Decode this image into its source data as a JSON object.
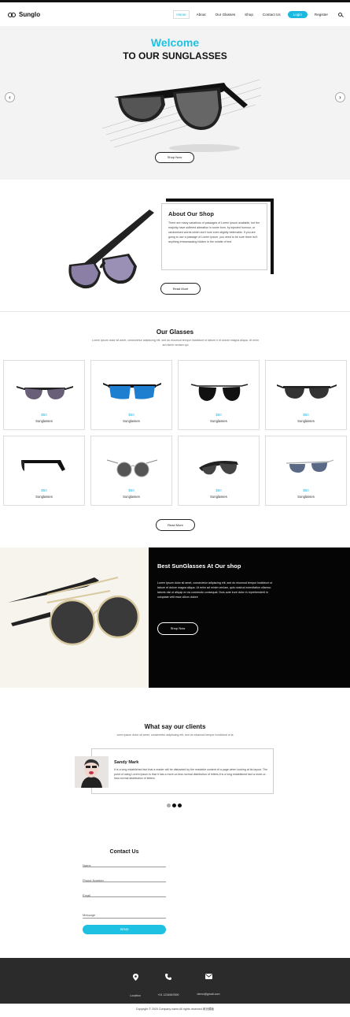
{
  "header": {
    "brand": "Sunglo",
    "nav": [
      "Home",
      "About",
      "Our Glasses",
      "Shop",
      "Contact Us"
    ],
    "login": "Login",
    "register": "Register"
  },
  "hero": {
    "welcome": "Welcome",
    "title": "TO OUR SUNGLASSES",
    "button": "Shop Now"
  },
  "about": {
    "title": "About Our Shop",
    "text": "There are many variations of passages of Lorem Ipsum available, but the majority have suffered alteration in some form, by injected humour, or randomised words which don't look even slightly believable. If you are going to use a passage of Lorem Ipsum, you need to be sure there isn't anything embarrassing hidden in the middle of text",
    "button": "Read More"
  },
  "glasses": {
    "title": "Our Glasses",
    "subtitle": "Lorem ipsum dolor sit amet, consectetur adipiscing elit, sed do eiusmod tempor incididunt ut labore e et dolore magna aliqua. Ut enim ad minim veniam qui",
    "products": [
      {
        "price": "$50",
        "name": "Sunglasses",
        "style": "cat"
      },
      {
        "price": "$50",
        "name": "Sunglasses",
        "style": "blue"
      },
      {
        "price": "$50",
        "name": "Sunglasses",
        "style": "aviator"
      },
      {
        "price": "$50",
        "name": "Sunglasses",
        "style": "wide"
      },
      {
        "price": "$50",
        "name": "Sunglasses",
        "style": "side"
      },
      {
        "price": "$50",
        "name": "Sunglasses",
        "style": "round"
      },
      {
        "price": "$50",
        "name": "Sunglasses",
        "style": "sport"
      },
      {
        "price": "$50",
        "name": "Sunglasses",
        "style": "silver"
      }
    ],
    "button": "Read More"
  },
  "best": {
    "title": "Best SunGlasses At Our shop",
    "text": "Lorem ipsum dolor sit amet, consectetur adipiscing elit, sed do eiusmod tempor incididunt ut labore et dolore magna aliqua. Ut enim ad minim veniam, quis nostrud exercitation ullamco laboris nisi ut aliquip ex ea commodo consequat. Duis aute irure dolor in reprehenderit in voluptate velit esse cillum dolore",
    "button": "Shop Now"
  },
  "clients": {
    "title": "What say our clients",
    "subtitle": "orem ipsum dolor sit amet, consectetur adipiscing elit, sed do eiusmod tempor incididunt ut la",
    "name": "Sandy Mark",
    "quote": "It is a long established fact that a reader will be distracted by the readable content of a page when looking at its layout. The point of using Lorem Ipsum is that it has a more-or-less normal distribution of letters,it is a long established fact a more-or-less normal distribution of letters."
  },
  "contact": {
    "title": "Contact Us",
    "name_ph": "Name",
    "phone_ph": "Phone Number",
    "email_ph": "Email",
    "message_ph": "Message",
    "send": "SEND"
  },
  "footer": {
    "location": "Location",
    "phone": "+01 1234567890",
    "email": "demo@gmail.com",
    "copyright": "Copyright © 2020 Company name All rights reserved 网页模板"
  },
  "colors": {
    "accent": "#1fc1e2",
    "dark": "#050505",
    "footer": "#2b2b2b"
  }
}
